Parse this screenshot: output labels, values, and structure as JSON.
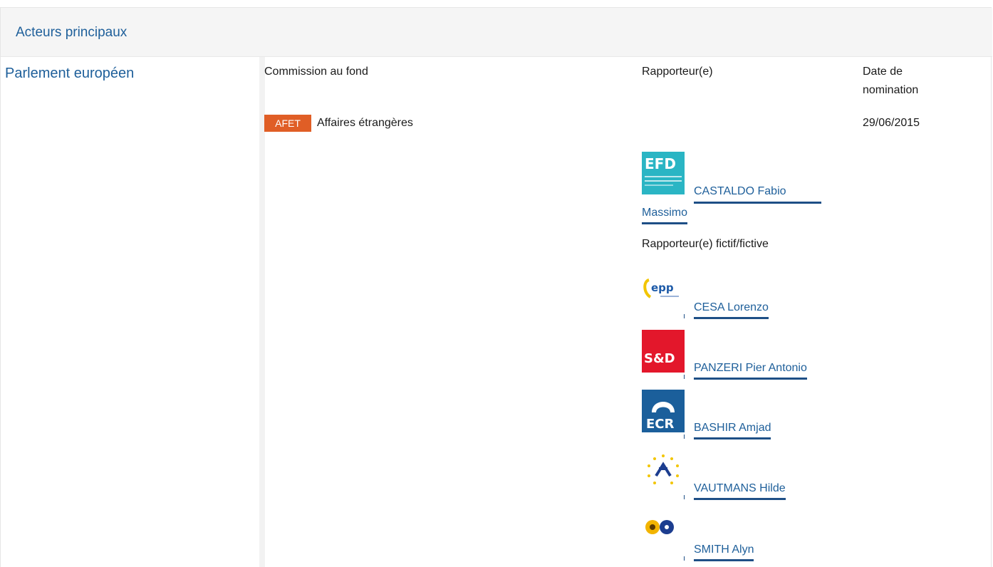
{
  "section": {
    "title": "Acteurs principaux"
  },
  "institution": {
    "label": "Parlement européen"
  },
  "columns": {
    "committee": "Commission au fond",
    "rapporteur": "Rapporteur(e)",
    "date_line1": "Date de",
    "date_line2": "nomination"
  },
  "committee": {
    "code": "AFET",
    "name": "Affaires étrangères",
    "date": "29/06/2015"
  },
  "rapporteur": {
    "group_logo": "EFD",
    "group_logo_color": "#2ab5c4",
    "name_line1": "CASTALDO Fabio",
    "name_line2": "Massimo"
  },
  "shadow_label": "Rapporteur(e) fictif/fictive",
  "shadows": [
    {
      "name": "CESA Lorenzo",
      "group_logo": "epp",
      "group_logo_color": "#1d5aa8"
    },
    {
      "name": "PANZERI Pier Antonio",
      "group_logo": "S&D",
      "group_logo_color": "#e3172b"
    },
    {
      "name": "BASHIR Amjad",
      "group_logo": "ECR",
      "group_logo_color": "#1b5f9b"
    },
    {
      "name": "VAUTMANS Hilde",
      "group_logo": "alde-icon",
      "group_logo_color": "#1c3d8f"
    },
    {
      "name": "SMITH Alyn",
      "group_logo": "greens-efa-icon",
      "group_logo_color": "#f2b400"
    }
  ],
  "colors": {
    "accent": "#1e5f9a",
    "badge": "#e05e26"
  }
}
